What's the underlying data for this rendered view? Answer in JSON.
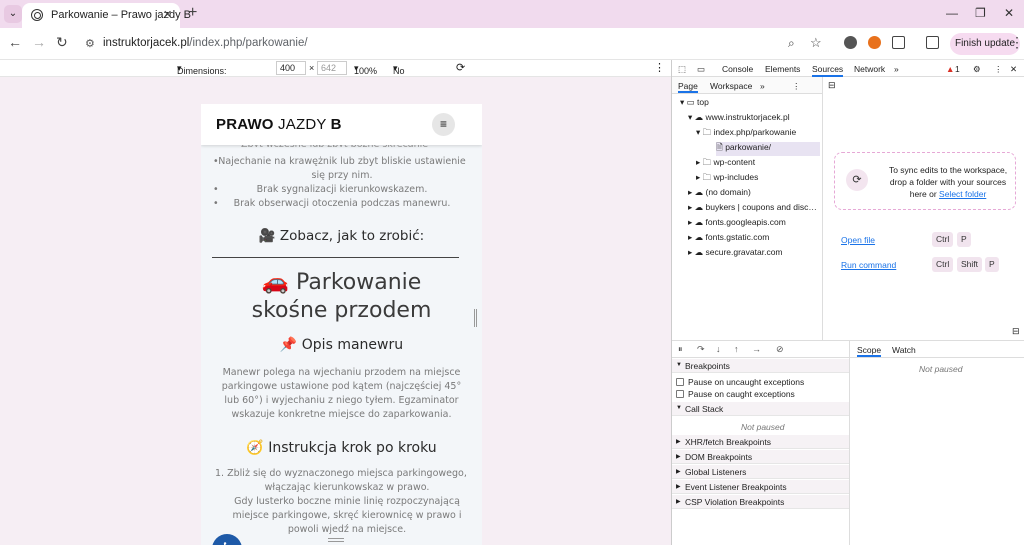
{
  "tab": {
    "title": "Parkowanie – Prawo jazdy B",
    "close": "✕",
    "new_tab": "+"
  },
  "window": {
    "minimize": "—",
    "restore": "❐",
    "close": "✕"
  },
  "toolbar": {
    "url_host": "instruktorjacek.pl",
    "url_path": "/index.php/parkowanie/",
    "finish_update": "Finish update"
  },
  "device_toolbar": {
    "dimensions_label": "Dimensions: Responsive",
    "width": "400",
    "times": "×",
    "height_placeholder": "642",
    "zoom": "100%",
    "throttling": "No throttling"
  },
  "site": {
    "logo_bold1": "PRAWO",
    "logo_light": "JAZDY",
    "logo_bold2": "B",
    "cut_line": "Zbyt wczesne lub zbyt późne skręcanie kierownicą.",
    "bullets": [
      "Najechanie na krawężnik lub zbyt bliskie ustawienie się przy nim.",
      "Brak sygnalizacji kierunkowskazem.",
      "Brak obserwacji otoczenia podczas manewru."
    ],
    "see_heading": "🎥 Zobacz, jak to zrobić:",
    "big_heading_line1": "🚗 Parkowanie",
    "big_heading_line2": "skośne przodem",
    "desc_heading": "📌 Opis manewru",
    "desc_text": "Manewr polega na wjechaniu przodem na miejsce parkingowe ustawione pod kątem (najczęściej 45° lub 60°) i wyjechaniu z niego tyłem. Egzaminator wskazuje konkretne miejsce do zaparkowania.",
    "steps_heading": "🧭 Instrukcja krok po kroku",
    "step1": "Zbliż się do wyznaczonego miejsca parkingowego, włączając kierunkowskaz w prawo.",
    "step2": "Gdy lusterko boczne minie linię rozpoczynającą miejsce parkingowe, skręć kierownicę w prawo i powoli wjedź na miejsce.",
    "step1_num": "1."
  },
  "devtools": {
    "tabs": [
      "Console",
      "Elements",
      "Sources",
      "Network"
    ],
    "warnings": "1",
    "sub_tabs": [
      "Page",
      "Workspace"
    ],
    "tree": [
      "top",
      "www.instruktorjacek.pl",
      "index.php/parkowanie",
      "parkowanie/",
      "wp-content",
      "wp-includes",
      "(no domain)",
      "buykers | coupons and disc…",
      "fonts.googleapis.com",
      "fonts.gstatic.com",
      "secure.gravatar.com"
    ],
    "sync_text": "To sync edits to the workspace, drop a folder with your sources here or",
    "sync_link": "Select folder",
    "open_file": "Open file",
    "run_command": "Run command",
    "kbd_ctrl": "Ctrl",
    "kbd_p": "P",
    "kbd_shift": "Shift",
    "scope_tabs": [
      "Scope",
      "Watch"
    ],
    "not_paused": "Not paused",
    "breakpoints": "Breakpoints",
    "pause_uncaught": "Pause on uncaught exceptions",
    "pause_caught": "Pause on caught exceptions",
    "call_stack": "Call Stack",
    "sections": [
      "XHR/fetch Breakpoints",
      "DOM Breakpoints",
      "Global Listeners",
      "Event Listener Breakpoints",
      "CSP Violation Breakpoints"
    ]
  }
}
